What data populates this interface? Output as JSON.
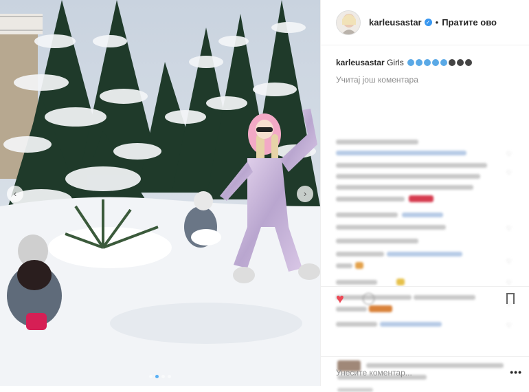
{
  "post": {
    "username": "karleusastar",
    "separator": "•",
    "follow_label": "Пратите ово",
    "caption_text": "Girls",
    "caption_emoji_colors": [
      "#5aa9e6",
      "#5aa9e6",
      "#5aa9e6",
      "#5aa9e6",
      "#5aa9e6",
      "#444444",
      "#444444",
      "#444444"
    ],
    "load_more_label": "Учитај још коментара",
    "comment_placeholder": "Унесите коментар...",
    "more_options_label": "•••"
  },
  "carousel": {
    "prev_icon": "‹",
    "next_icon": "›",
    "slides": 4,
    "active_index": 1
  },
  "icons": {
    "like_icon": "♥",
    "comment_icon": "◯",
    "verified_icon": "✓"
  },
  "colors": {
    "accent": "#3897f0",
    "like": "#ed4956",
    "text": "#262626",
    "muted": "#8e8e8e"
  }
}
